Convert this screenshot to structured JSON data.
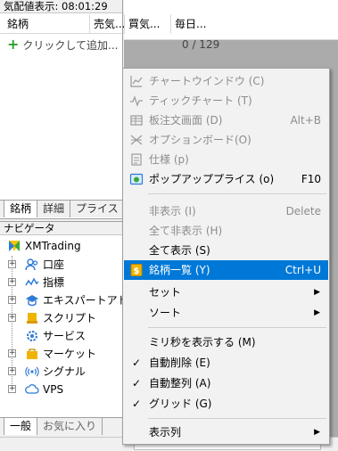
{
  "market_watch": {
    "title": "気配値表示: 08:01:29",
    "columns": [
      "銘柄",
      "売気...",
      "買気...",
      "毎日..."
    ],
    "add_row_label": "クリックして追加...",
    "symbol_count": "0 / 129",
    "tabs": [
      "銘柄",
      "詳細",
      "プライス"
    ]
  },
  "navigator": {
    "title": "ナビゲータ",
    "root": "XMTrading",
    "items": [
      {
        "label": "口座",
        "icon": "accounts-icon"
      },
      {
        "label": "指標",
        "icon": "indicators-icon"
      },
      {
        "label": "エキスパートアドバイザ",
        "icon": "expert-advisors-icon"
      },
      {
        "label": "スクリプト",
        "icon": "scripts-icon"
      },
      {
        "label": "サービス",
        "icon": "services-icon"
      },
      {
        "label": "マーケット",
        "icon": "market-icon"
      },
      {
        "label": "シグナル",
        "icon": "signals-icon"
      },
      {
        "label": "VPS",
        "icon": "vps-icon"
      }
    ],
    "tabs": [
      "一般",
      "お気に入り"
    ]
  },
  "context_menu": {
    "items": [
      {
        "label": "チャートウインドウ (C)",
        "shortcut": "",
        "disabled": true,
        "icon": "chart-window-icon"
      },
      {
        "label": "ティックチャート (T)",
        "shortcut": "",
        "disabled": true,
        "icon": "tick-chart-icon"
      },
      {
        "label": "板注文画面 (D)",
        "shortcut": "Alt+B",
        "disabled": true,
        "icon": "depth-of-market-icon"
      },
      {
        "label": "オプションボード(O)",
        "shortcut": "",
        "disabled": true,
        "icon": "option-board-icon"
      },
      {
        "label": "仕様 (p)",
        "shortcut": "",
        "disabled": true,
        "icon": "specification-icon"
      },
      {
        "label": "ポップアッププライス (o)",
        "shortcut": "F10",
        "disabled": false,
        "icon": "popup-prices-icon"
      },
      {
        "label": "非表示 (I)",
        "shortcut": "Delete",
        "disabled": true
      },
      {
        "label": "全て非表示 (H)",
        "shortcut": "",
        "disabled": true
      },
      {
        "label": "全て表示 (S)",
        "shortcut": "",
        "disabled": false
      },
      {
        "label": "銘柄一覧 (Y)",
        "shortcut": "Ctrl+U",
        "disabled": false,
        "highlighted": true,
        "icon": "symbols-icon"
      },
      {
        "label": "セット",
        "submenu": true
      },
      {
        "label": "ソート",
        "submenu": true
      },
      {
        "label": "ミリ秒を表示する (M)",
        "checked": false
      },
      {
        "label": "自動削除 (E)",
        "checked": true
      },
      {
        "label": "自動整列 (A)",
        "checked": true
      },
      {
        "label": "グリッド (G)",
        "checked": true
      },
      {
        "label": "表示列",
        "submenu": true
      }
    ],
    "submenu_arrow": "▶",
    "check_mark": "✓",
    "colors": {
      "highlight": "#0078d7",
      "disabled_text": "#8c8c8c"
    }
  }
}
